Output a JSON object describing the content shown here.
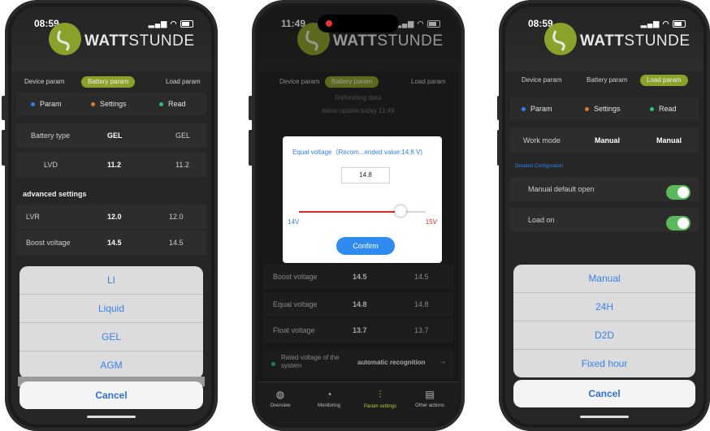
{
  "phone1": {
    "time": "08:59",
    "brand_bold": "WATT",
    "brand_rest": "STUNDE",
    "tabs": [
      "Device param",
      "Battery param",
      "Load param"
    ],
    "legend": {
      "param": "Param",
      "settings": "Settings",
      "read": "Read"
    },
    "rows": [
      {
        "label": "Battery type",
        "setting": "GEL",
        "read": "GEL"
      },
      {
        "label": "LVD",
        "setting": "11.2",
        "read": "11.2"
      }
    ],
    "advanced_title": "advanced settings",
    "adv_rows": [
      {
        "label": "LVR",
        "setting": "12.0",
        "read": "12.0"
      },
      {
        "label": "Boost voltage",
        "setting": "14.5",
        "read": "14.5"
      }
    ],
    "options": [
      "LI",
      "Liquid",
      "GEL",
      "AGM"
    ],
    "cancel": "Cancel"
  },
  "phone2": {
    "time": "11:49",
    "brand_bold": "WATT",
    "brand_rest": "STUNDE",
    "tabs": [
      "Device param",
      "Battery param",
      "Load param"
    ],
    "refreshing": "Refreshing data",
    "latest_update": "latest update:today 11:49",
    "rows": [
      {
        "label": "Boost voltage",
        "setting": "14.5",
        "read": "14.5"
      },
      {
        "label": "Equal voltage",
        "setting": "14.8",
        "read": "14.8"
      },
      {
        "label": "Float voltage",
        "setting": "13.7",
        "read": "13.7"
      }
    ],
    "rated_label": "Rated voltage of the system",
    "rated_value": "automatic recognition",
    "rated_arrow": "→",
    "modal": {
      "title": "Equal voltage（Recom...ended value:14.8 V)",
      "value": "14.8",
      "min": "14V",
      "max": "15V",
      "slider_fraction": 0.8,
      "confirm": "Confirm"
    },
    "nav": [
      "Overview",
      "Monitoring",
      "Param settings",
      "Other actions"
    ]
  },
  "phone3": {
    "time": "08:59",
    "brand_bold": "WATT",
    "brand_rest": "STUNDE",
    "tabs": [
      "Device param",
      "Battery param",
      "Load param"
    ],
    "legend": {
      "param": "Param",
      "settings": "Settings",
      "read": "Read"
    },
    "work_mode": {
      "label": "Work mode",
      "setting": "Manual",
      "read": "Manual"
    },
    "detailed": "Detailed Configuration",
    "toggles": [
      {
        "label": "Manual default open",
        "on": true
      },
      {
        "label": "Load on",
        "on": true
      }
    ],
    "options": [
      "Manual",
      "24H",
      "D2D",
      "Fixed hour"
    ],
    "cancel": "Cancel"
  },
  "colors": {
    "accent_green": "#8aa12a",
    "ios_blue": "#3a82e8",
    "slider_red": "#e02828",
    "toggle_green": "#5cb85c",
    "dot_blue": "#2f80e8",
    "dot_orange": "#e0782a",
    "dot_green": "#2ec27e"
  }
}
